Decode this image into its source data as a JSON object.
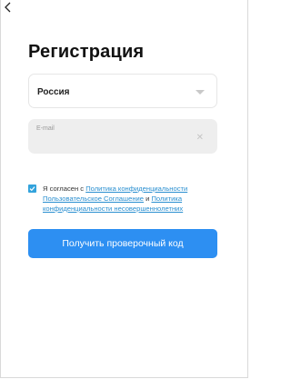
{
  "header": {
    "back_icon": "chevron-left-icon"
  },
  "page": {
    "title": "Регистрация"
  },
  "form": {
    "country_value": "Россия",
    "country_caret_icon": "caret-down-icon",
    "email_placeholder": "E-mail",
    "email_value": "",
    "email_clear_icon": "close-icon"
  },
  "agreement": {
    "checked": true,
    "prefix": "Я согласен с ",
    "link_privacy": "Политика конфиденциальности",
    "link_terms": "Пользовательское Соглашение",
    "conjunction": " и ",
    "link_minors": "Политика конфиденциальности несовершеннолетних"
  },
  "actions": {
    "submit_label": "Получить проверочный код"
  },
  "colors": {
    "accent": "#2d8ff2",
    "link": "#2a8fd0",
    "checkbox": "#33a3dc",
    "input_bg": "#eeeeee"
  }
}
